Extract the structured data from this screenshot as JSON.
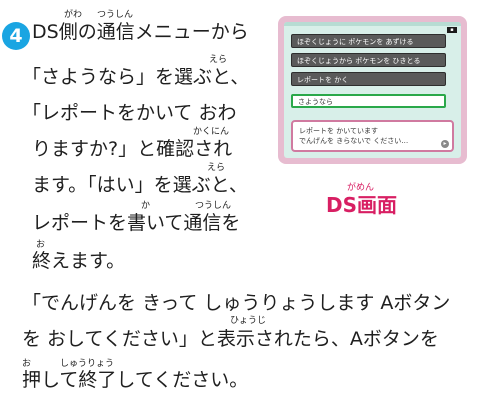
{
  "step": {
    "number": "4"
  },
  "body_lines": [
    "DS側の通信メニューから",
    "「さようなら」を選ぶと、",
    "「レポートをかいて おわ",
    "りますか?」と確認され",
    "ます。「はい」を選ぶと、",
    "レポートを書いて通信を",
    "終えます。"
  ],
  "furigana": {
    "gawa": "がわ",
    "tsuushin": "つうしん",
    "erabu1": "えら",
    "kakunin": "かくにん",
    "erabu2": "えら",
    "ka": "か",
    "tsuushin2": "つうしん",
    "o": "お",
    "hyouji": "ひょうじ",
    "o2": "お",
    "shuuryou": "しゅうりょう"
  },
  "note_lines": [
    "「でんげんを きって しゅうりょうします Aボタン",
    "を おしてください」と表示されたら、Aボタンを",
    "押して終了してください。"
  ],
  "ds_screen": {
    "menu_items": [
      "ほぞくじょうに ポケモンを あずける",
      "ほぞくじょうから ポケモンを ひきとる",
      "レポートを かく",
      "さようなら"
    ],
    "selected_index": 3,
    "message_line1": "レポートを かいています",
    "message_line2": "でんげんを きらないで ください…",
    "caption_ruby": "がめん",
    "caption": "DS画面"
  },
  "colors": {
    "accent_blue": "#1aa5e2",
    "caption_pink": "#d81f63",
    "ds_frame": "#e7bcd0"
  }
}
